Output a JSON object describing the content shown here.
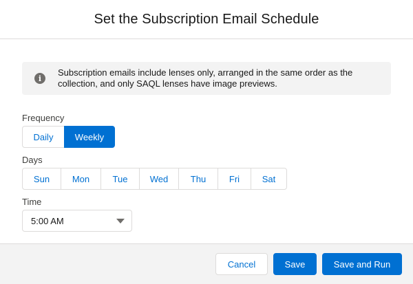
{
  "dialog": {
    "title": "Set the Subscription Email Schedule"
  },
  "info": {
    "icon": "info-icon",
    "text": "Subscription emails include lenses only, arranged in the same order as the collection, and only SAQL lenses have image previews."
  },
  "frequency": {
    "label": "Frequency",
    "options": [
      "Daily",
      "Weekly"
    ],
    "selected": "Weekly"
  },
  "days": {
    "label": "Days",
    "options": [
      "Sun",
      "Mon",
      "Tue",
      "Wed",
      "Thu",
      "Fri",
      "Sat"
    ]
  },
  "time": {
    "label": "Time",
    "value": "5:00 AM",
    "icon": "chevron-down-icon"
  },
  "footer": {
    "cancel_label": "Cancel",
    "save_label": "Save",
    "save_run_label": "Save and Run"
  },
  "colors": {
    "brand": "#0070d2",
    "footer_bg": "#f3f3f3",
    "border": "#dddbda"
  }
}
